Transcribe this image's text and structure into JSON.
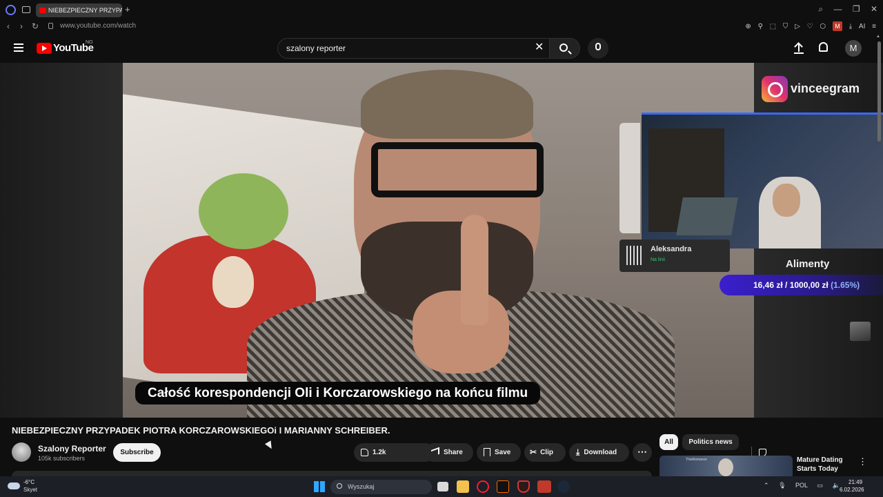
{
  "browser": {
    "tab_title": "NIEBEZPIECZNY PRZYPAD",
    "new_tab_label": "+",
    "url": "www.youtube.com/watch",
    "extension_badge": "M",
    "ai_label": "AI",
    "window_controls": [
      "⌕",
      "—",
      "❐",
      "✕"
    ],
    "nav": {
      "back": "‹",
      "forward": "›",
      "reload": "↻"
    }
  },
  "youtube": {
    "logo_text": "YouTube",
    "region": "NO",
    "search_value": "szalony reporter",
    "search_clear": "✕",
    "avatar_letter": "M"
  },
  "video": {
    "subtitle": "Całość korespondencji Oli i Korczarowskiego na końcu filmu",
    "overlay": {
      "instagram_handle": "vinceegram",
      "call_name": "Aleksandra",
      "call_status": "Na linii",
      "goal_title": "Alimenty",
      "goal_amount": "16,46 zł / 1000,00 zł",
      "goal_percent": "(1.65%)"
    }
  },
  "details": {
    "title": "NIEBEZPIECZNY PRZYPADEK PIOTRA KORCZAROWSKIEGOi I MARIANNY SCHREIBER.",
    "channel_name": "Szalony Reporter",
    "subscribers": "105k subscribers",
    "subscribe_label": "Subscribe",
    "like_count": "1.2k",
    "share_label": "Share",
    "save_label": "Save",
    "clip_label": "Clip",
    "download_label": "Download",
    "more_label": "⋯"
  },
  "sidebar": {
    "chips": [
      "All",
      "Politics news"
    ],
    "recommendation": {
      "title": "Mature Dating Starts Today",
      "thumb_text": "ThisRomance"
    }
  },
  "taskbar": {
    "temperature": "-6°C",
    "weather": "Skyet",
    "search_placeholder": "Wyszukaj",
    "language": "POL",
    "time": "21:49",
    "date": "6.02.2026"
  },
  "colors": {
    "youtube_red": "#ff0000",
    "background": "#0f0f0f",
    "goal_bar": "#3a1fcf",
    "accent_blue": "#2fa8ff"
  }
}
